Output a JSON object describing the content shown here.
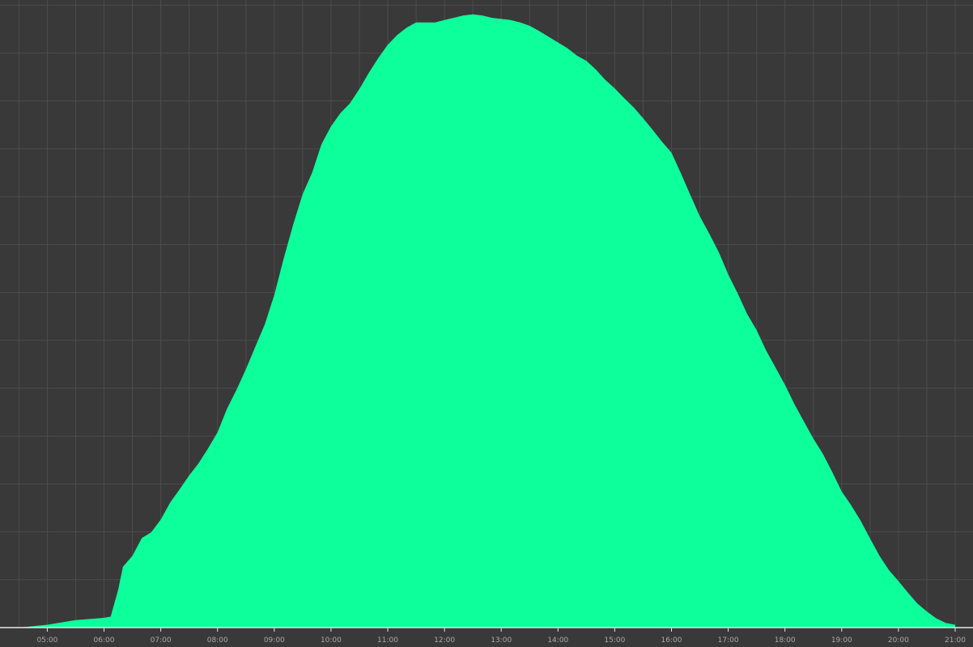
{
  "colors": {
    "background": "#393939",
    "grid": "#4c4c4c",
    "area": "#0dff9c",
    "axis": "#e8e8e8",
    "tick_text": "#a9a9a9"
  },
  "chart_data": {
    "type": "area",
    "title": "",
    "xlabel": "",
    "ylabel": "",
    "grid": true,
    "y_axis_labels_shown": false,
    "xlim": [
      "04:10",
      "21:00"
    ],
    "ylim": [
      0,
      100
    ],
    "x_ticks": [
      "05:00",
      "06:00",
      "07:00",
      "08:00",
      "09:00",
      "10:00",
      "11:00",
      "12:00",
      "13:00",
      "14:00",
      "15:00",
      "16:00",
      "17:00",
      "18:00",
      "19:00",
      "20:00",
      "21:00"
    ],
    "series": [
      {
        "x": [
          "04:30",
          "05:00",
          "05:30",
          "06:00",
          "06:07",
          "06:15",
          "06:20",
          "06:30",
          "06:40",
          "06:50",
          "07:00",
          "07:10",
          "07:20",
          "07:30",
          "07:40",
          "07:50",
          "08:00",
          "08:10",
          "08:20",
          "08:30",
          "08:40",
          "08:50",
          "09:00",
          "09:10",
          "09:20",
          "09:30",
          "09:40",
          "09:50",
          "10:00",
          "10:10",
          "10:20",
          "10:30",
          "10:40",
          "10:50",
          "11:00",
          "11:10",
          "11:20",
          "11:30",
          "11:40",
          "11:50",
          "12:00",
          "12:10",
          "12:20",
          "12:30",
          "12:40",
          "12:50",
          "13:00",
          "13:10",
          "13:20",
          "13:30",
          "13:40",
          "13:50",
          "14:00",
          "14:10",
          "14:20",
          "14:30",
          "14:40",
          "14:50",
          "15:00",
          "15:10",
          "15:20",
          "15:30",
          "15:40",
          "15:50",
          "16:00",
          "16:10",
          "16:20",
          "16:30",
          "16:40",
          "16:50",
          "17:00",
          "17:10",
          "17:20",
          "17:30",
          "17:40",
          "17:50",
          "18:00",
          "18:10",
          "18:20",
          "18:30",
          "18:40",
          "18:50",
          "19:00",
          "19:10",
          "19:20",
          "19:30",
          "19:40",
          "19:50",
          "20:00",
          "20:10",
          "20:20",
          "20:30",
          "20:40",
          "20:50",
          "21:00"
        ],
        "y": [
          0,
          0.5,
          1.3,
          1.7,
          1.9,
          6.6,
          10.6,
          12.5,
          15.6,
          16.6,
          18.8,
          21.8,
          24.1,
          26.5,
          28.6,
          31.2,
          34,
          38.1,
          41.4,
          45,
          48.9,
          52.8,
          57.9,
          64.3,
          70.2,
          75.5,
          79.2,
          84.2,
          87.3,
          89.6,
          91.3,
          93.8,
          96.6,
          99.2,
          101.5,
          103.2,
          104.5,
          105.4,
          105.4,
          105.4,
          105.8,
          106.2,
          106.6,
          106.8,
          106.6,
          106.2,
          106,
          105.8,
          105.4,
          104.8,
          103.9,
          102.9,
          101.9,
          100.9,
          99.6,
          98.7,
          97.2,
          95.4,
          93.9,
          92.2,
          90.6,
          88.7,
          86.7,
          84.6,
          82.7,
          79.1,
          75.3,
          71.6,
          68.6,
          65.4,
          61.5,
          58.2,
          54.6,
          51.8,
          48.3,
          45.3,
          42.3,
          38.9,
          35.9,
          32.9,
          30.3,
          27.1,
          23.7,
          21.3,
          18.6,
          15.5,
          12.5,
          10.0,
          8.1,
          6.1,
          4.2,
          2.8,
          1.6,
          0.8,
          0.5
        ]
      }
    ]
  }
}
